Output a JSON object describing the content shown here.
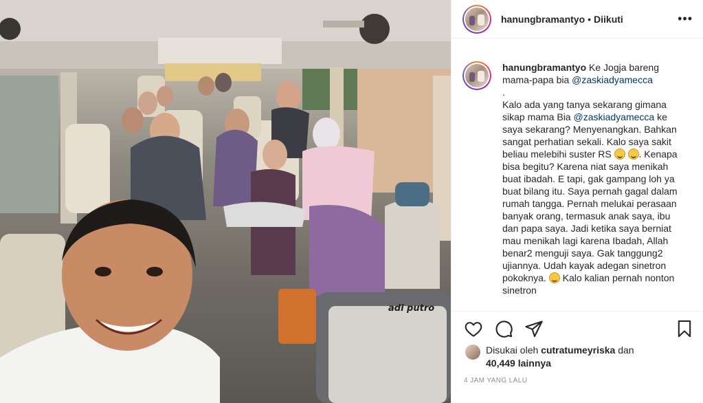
{
  "post": {
    "username": "hanungbramantyo",
    "separator": "•",
    "follow_status": "Diikuti",
    "more_icon": "more-horizontal-icon",
    "photo_label": "adi putro"
  },
  "caption": {
    "username": "hanungbramantyo",
    "intro": " Ke Jogja bareng mama-papa bia ",
    "mention": "@zaskiadyamecca",
    "para1": "\n.\nKalo ada yang tanya sekarang gimana sikap mama Bia ",
    "mention2": "@zaskiadyamecca",
    "para2": " ke saya sekarang? Menyenangkan. Bahkan sangat perhatian sekali. Kalo saya sakit beliau melebihi suster RS ",
    "para3": ". Kenapa bisa begitu? Karena niat saya menikah buat ibadah. E tapi, gak gampang loh ya buat bilang itu. Saya pernah gagal dalam rumah tangga. Pernah melukai perasaan banyak orang, termasuk anak saya, ibu dan papa saya. Jadi ketika saya berniat mau menikah lagi karena Ibadah, Allah benar2 menguji saya. Gak tanggung2 ujiannya. Udah kayak adegan sinetron pokoknya. ",
    "para4": " Kalo kalian pernah nonton sinetron"
  },
  "actions": {
    "like_icon": "heart-icon",
    "comment_icon": "comment-icon",
    "share_icon": "paper-plane-icon",
    "save_icon": "bookmark-icon"
  },
  "likes": {
    "prefix": "Disukai oleh ",
    "liker": "cutratumeyriska",
    "connector": " dan",
    "count": "40,449 lainnya"
  },
  "timestamp": "4 JAM YANG LALU"
}
